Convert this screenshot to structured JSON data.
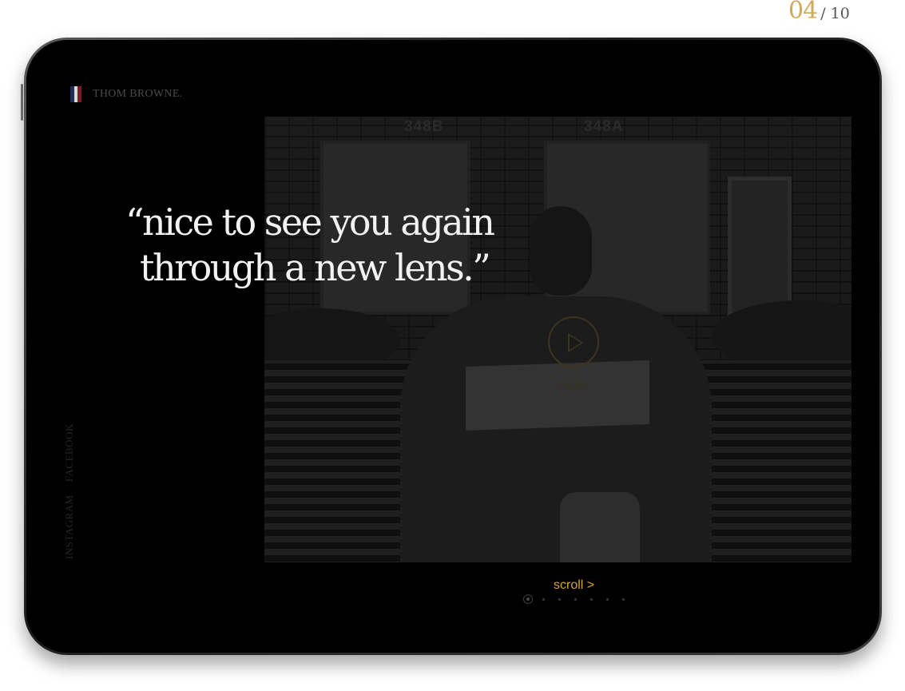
{
  "slide_counter": {
    "current": "04",
    "total": "/ 10"
  },
  "brand": {
    "name": "THOM BROWNE.",
    "flag_colors": [
      "#1f2a55",
      "#e8e8e8",
      "#8a1c24"
    ]
  },
  "hero": {
    "quote_line1": "“nice to see you again",
    "quote_line2": "through a new lens.”",
    "photo_numbers": [
      "348B",
      "348A"
    ],
    "play_label": "PLAY"
  },
  "social": {
    "instagram": "INSTAGRAM",
    "facebook": "FACEBOOK"
  },
  "navigation": {
    "scroll_label": "scroll >",
    "dot_count": 7,
    "active_dot": 1
  },
  "colors": {
    "accent": "#d6a62c",
    "screen": "#000000",
    "counter_accent": "#cfa95a"
  }
}
